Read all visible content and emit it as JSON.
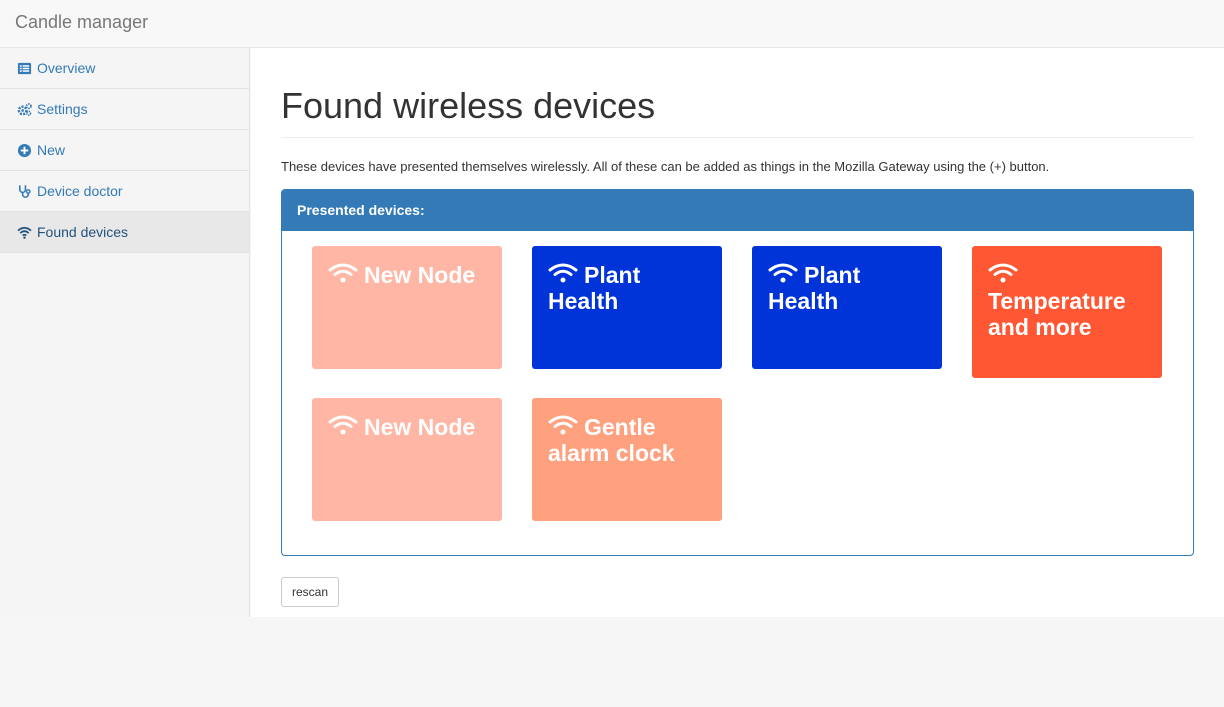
{
  "app": {
    "brand": "Candle manager"
  },
  "sidebar": {
    "items": [
      {
        "label": "Overview",
        "icon": "list-icon"
      },
      {
        "label": "Settings",
        "icon": "gears-icon"
      },
      {
        "label": "New",
        "icon": "plus-circle-icon"
      },
      {
        "label": "Device doctor",
        "icon": "stethoscope-icon"
      },
      {
        "label": "Found devices",
        "icon": "wifi-icon",
        "active": true
      }
    ]
  },
  "main": {
    "title": "Found wireless devices",
    "intro": "These devices have presented themselves wirelessly. All of these can be added as things in the Mozilla Gateway using the (+) button.",
    "panel": {
      "heading": "Presented devices:",
      "devices": [
        {
          "name": "New Node",
          "color": "#ffb6a5"
        },
        {
          "name": "Plant Health",
          "color": "#0033d8"
        },
        {
          "name": "Plant Health",
          "color": "#0033d8"
        },
        {
          "name": "Temperature and more",
          "color": "#ff5733"
        },
        {
          "name": "New Node",
          "color": "#ffb6a5"
        },
        {
          "name": "Gentle alarm clock",
          "color": "#ffa07f"
        }
      ]
    },
    "rescan_label": "rescan"
  },
  "colors": {
    "primary": "#337ab7",
    "link": "#337ab7"
  }
}
